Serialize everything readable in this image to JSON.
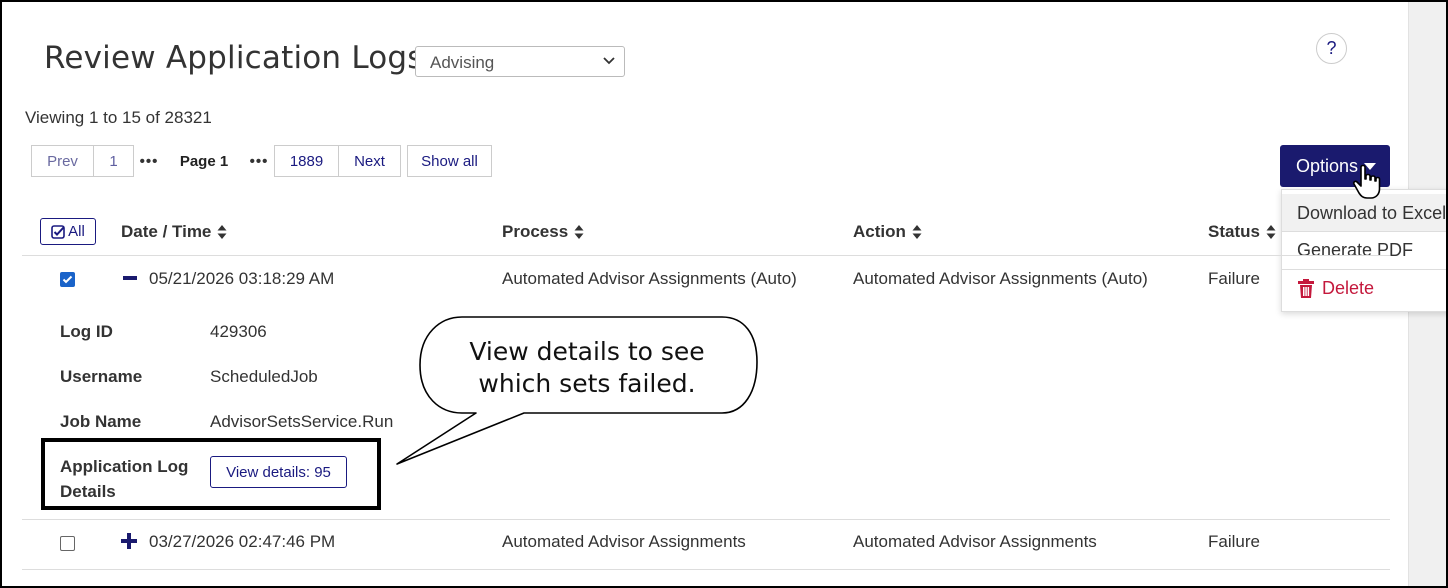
{
  "page": {
    "title": "Review Application Logs",
    "filter_value": "Advising",
    "help_label": "?",
    "viewing_text": "Viewing 1 to 15 of 28321"
  },
  "pager": {
    "prev": "Prev",
    "first": "1",
    "dots": "•••",
    "current": "Page 1",
    "last": "1889",
    "next": "Next",
    "show_all": "Show all"
  },
  "options": {
    "label": "Options",
    "menu": [
      "Download to Excel",
      "Generate PDF",
      "Delete"
    ]
  },
  "table": {
    "select_all": "All",
    "columns": [
      "Date / Time",
      "Process",
      "Action",
      "Status"
    ],
    "rows": [
      {
        "checked": true,
        "expanded": true,
        "datetime": "05/21/2026 03:18:29 AM",
        "process": "Automated Advisor Assignments (Auto)",
        "action": "Automated Advisor Assignments (Auto)",
        "status": "Failure"
      },
      {
        "checked": false,
        "expanded": false,
        "datetime": "03/27/2026 02:47:46 PM",
        "process": "Automated Advisor Assignments",
        "action": "Automated Advisor Assignments",
        "status": "Failure"
      }
    ]
  },
  "details": {
    "log_id_label": "Log ID",
    "log_id": "429306",
    "username_label": "Username",
    "username": "ScheduledJob",
    "job_name_label": "Job Name",
    "job_name": "AdvisorSetsService.Run",
    "app_log_label_1": "Application Log",
    "app_log_label_2": "Details",
    "view_details": "View details: 95"
  },
  "callout": {
    "line1": "View details to see",
    "line2": "which sets failed."
  },
  "colors": {
    "primary": "#1a1a6e",
    "link": "#1a1a80",
    "danger": "#c4183c",
    "checkbox": "#1a63c9"
  }
}
